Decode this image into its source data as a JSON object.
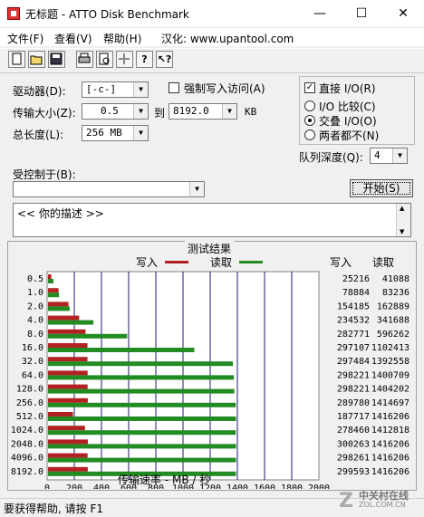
{
  "window": {
    "title": "无标题 - ATTO Disk Benchmark",
    "minimize": "—",
    "maximize": "☐",
    "close": "✕"
  },
  "menu": {
    "file": "文件(F)",
    "view": "查看(V)",
    "help": "帮助(H)",
    "localized_by": "汉化: www.upantool.com"
  },
  "toolbar": {
    "icons": [
      "new-icon",
      "open-icon",
      "save-icon",
      "print-icon",
      "print-preview-icon",
      "move-icon",
      "help-icon",
      "context-help-icon"
    ]
  },
  "controls": {
    "drive_label": "驱动器(D):",
    "drive_value": "[-c-]",
    "force_write_label": "强制写入访问(A)",
    "force_write_checked": false,
    "transfer_label": "传输大小(Z):",
    "transfer_from": "0.5",
    "transfer_to_label": "到",
    "transfer_to": "8192.0",
    "transfer_unit": "KB",
    "length_label": "总长度(L):",
    "length_value": "256 MB",
    "direct_io_label": "直接 I/O(R)",
    "direct_io_checked": true,
    "io_compare": "I/O 比较(C)",
    "overlapped_io": "交叠 I/O(O)",
    "neither": "两者都不(N)",
    "selected_io": "overlapped",
    "queue_label": "队列深度(Q):",
    "queue_value": "4",
    "controlled_by_label": "受控制于(B):",
    "controlled_by_value": "",
    "start_button": "开始(S)",
    "description": "<<  你的描述  >>"
  },
  "results": {
    "title": "测试结果",
    "write_legend": "写入",
    "read_legend": "读取",
    "write_header": "写入",
    "read_header": "读取",
    "write_color": "#b22222",
    "read_color": "#228b22",
    "xlabel": "传输速率 - MB / 秒"
  },
  "chart_data": {
    "type": "bar",
    "orientation": "horizontal",
    "categories": [
      "0.5",
      "1.0",
      "2.0",
      "4.0",
      "8.0",
      "16.0",
      "32.0",
      "64.0",
      "128.0",
      "256.0",
      "512.0",
      "1024.0",
      "2048.0",
      "4096.0",
      "8192.0"
    ],
    "series": [
      {
        "name": "写入",
        "values_mb": [
          24.6,
          77.0,
          150.5,
          229.0,
          276.1,
          290.1,
          290.5,
          291.2,
          291.2,
          292.9,
          183.3,
          271.9,
          293.2,
          291.3,
          292.6
        ],
        "values_kb": [
          25216,
          78884,
          154185,
          234532,
          282771,
          297107,
          297484,
          298221,
          298221,
          289780,
          187717,
          278460,
          300263,
          298261,
          299593
        ]
      },
      {
        "name": "读取",
        "values_mb": [
          40.1,
          81.3,
          158.9,
          333.7,
          582.3,
          1076.3,
          1360.9,
          1367.9,
          1371.3,
          1381.5,
          1382.8,
          1380.7,
          1382.8,
          1382.8,
          1382.8
        ],
        "values_kb": [
          41088,
          83236,
          162889,
          341688,
          596262,
          1102413,
          1392558,
          1400709,
          1404202,
          1414697,
          1416206,
          1412818,
          1416206,
          1416206,
          1416206
        ]
      }
    ],
    "xlim": [
      0,
      2000
    ],
    "xticks": [
      "0",
      "200",
      "400",
      "600",
      "800",
      "1000",
      "1200",
      "1400",
      "1600",
      "1800",
      "2000"
    ],
    "xlabel": "传输速率 - MB / 秒"
  },
  "statusbar": {
    "text": "要获得帮助, 请按 F1"
  },
  "watermark": {
    "brand": "中关村在线",
    "domain": "ZOL.COM.CN"
  }
}
